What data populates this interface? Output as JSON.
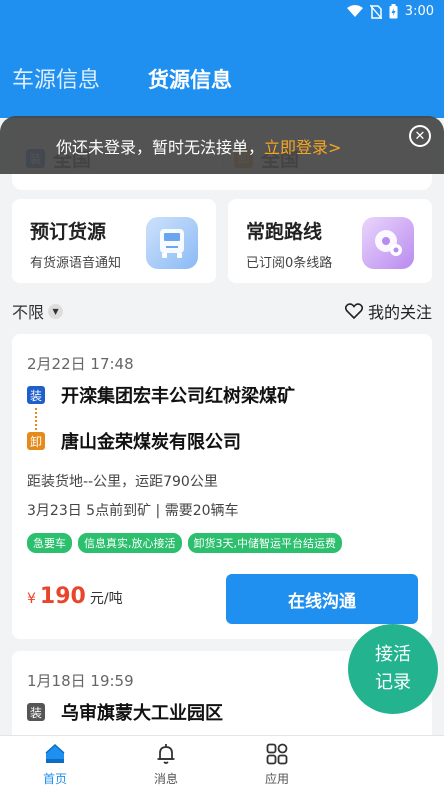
{
  "status_bar": {
    "time": "3:00"
  },
  "tabs": [
    {
      "label": "车源信息"
    },
    {
      "label": "货源信息"
    }
  ],
  "route": {
    "load_tag": "装",
    "load_value": "全国",
    "unload_tag": "卸",
    "unload_value": "全国"
  },
  "login_banner": {
    "text": "你还未登录，暂时无法接单，",
    "link": "立即登录>"
  },
  "features": [
    {
      "title": "预订货源",
      "subtitle": "有货源语音通知",
      "icon": "truck-icon"
    },
    {
      "title": "常跑路线",
      "subtitle": "已订阅0条线路",
      "icon": "route-icon"
    }
  ],
  "filter": {
    "left_label": "不限",
    "right_label": "我的关注"
  },
  "cargo_list": [
    {
      "time": "2月22日 17:48",
      "load_tag": "装",
      "load_addr": "开滦集团宏丰公司红树梁煤矿",
      "unload_tag": "卸",
      "unload_addr": "唐山金荣煤炭有限公司",
      "distance": "距装货地--公里，运距790公里",
      "schedule": "3月23日 5点前到矿 | 需要20辆车",
      "chips": [
        "急要车",
        "信息真实,放心接活",
        "卸货3天,中储智运平台结运费"
      ],
      "price_symbol": "¥",
      "price": "190",
      "price_unit": "元/吨",
      "action": "在线沟通"
    },
    {
      "time": "1月18日 19:59",
      "load_tag": "装",
      "load_addr": "乌审旗蒙大工业园区"
    }
  ],
  "fab": {
    "line1": "接活",
    "line2": "记录"
  },
  "bottom_nav": [
    {
      "label": "首页",
      "icon": "home-icon"
    },
    {
      "label": "消息",
      "icon": "bell-icon"
    },
    {
      "label": "应用",
      "icon": "apps-icon"
    }
  ],
  "colors": {
    "primary": "#1f8ff0",
    "accent_green": "#23b48f",
    "price_red": "#e8452c",
    "login_link": "#f5a623"
  }
}
